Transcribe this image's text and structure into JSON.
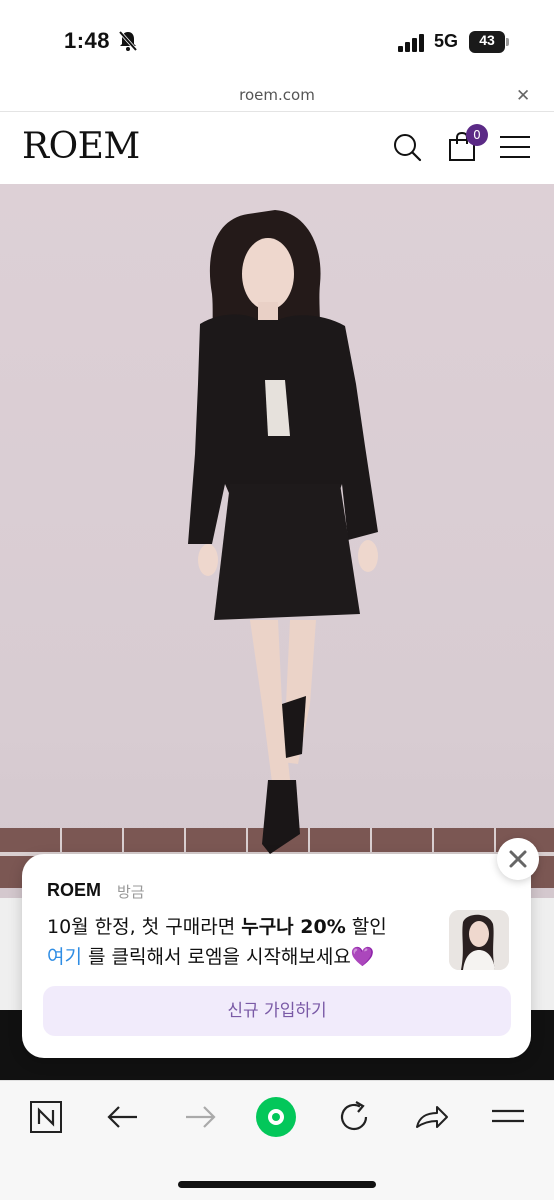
{
  "status_bar": {
    "time": "1:48",
    "network": "5G",
    "battery": "43",
    "icons": [
      "bell-slash-icon",
      "signal-bars-icon",
      "battery-icon"
    ]
  },
  "browser": {
    "url": "roem.com",
    "close_icon": "close-icon"
  },
  "site_header": {
    "logo": "ROEM",
    "cart_count": "0",
    "icons": [
      "search-icon",
      "shopping-bag-icon",
      "hamburger-menu-icon"
    ]
  },
  "popup": {
    "brand": "ROEM",
    "time": "방금",
    "line1_prefix": "10월 한정, 첫 구매라면 ",
    "line1_bold": "누구나 20%",
    "line1_suffix": " 할인",
    "line2_link": "여기",
    "line2_rest": " 를 클릭해서 로엠을 시작해보세요",
    "line2_emoji": "💜",
    "signup_label": "신규 가입하기",
    "close_icon": "close-icon"
  },
  "toolbar": {
    "icons": [
      "naver-n-icon",
      "back-arrow-icon",
      "forward-arrow-icon",
      "green-home-icon",
      "reload-icon",
      "share-icon",
      "menu-icon"
    ]
  },
  "colors": {
    "accent_purple": "#5b2a86",
    "link_blue": "#2f8de4",
    "signup_bg": "#f1ebfb",
    "naver_green": "#03c75a"
  }
}
